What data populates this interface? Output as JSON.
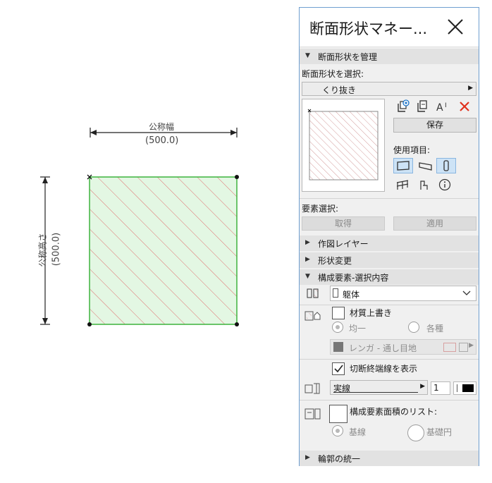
{
  "canvas": {
    "width_label": "公称幅",
    "width_value": "(500.0)",
    "height_label": "公称高さ",
    "height_value": "(500.0)"
  },
  "palette": {
    "title": "断面形状マネー...",
    "manage_section": "断面形状を管理",
    "select_label": "断面形状を選択:",
    "selected_profile": "くり抜き",
    "save_label": "保存",
    "usage_label": "使用項目:",
    "element_select_label": "要素選択:",
    "get_label": "取得",
    "apply_label": "適用",
    "section_drafting_layer": "作図レイヤー",
    "section_modify": "形状変更",
    "section_component": "構成要素-選択内容",
    "building_material": "躯体",
    "override_material_label": "材質上書き",
    "uniform_label": "均一",
    "various_label": "各種",
    "material_value": "レンガ - 通し目地",
    "show_cut_end_label": "切断終端線を表示",
    "line_type": "実線",
    "pen_number": "1",
    "component_area_label": "構成要素面積のリスト:",
    "base_line_label": "基線",
    "base_circle_label": "基礎円",
    "section_contour": "輪郭の統一"
  }
}
